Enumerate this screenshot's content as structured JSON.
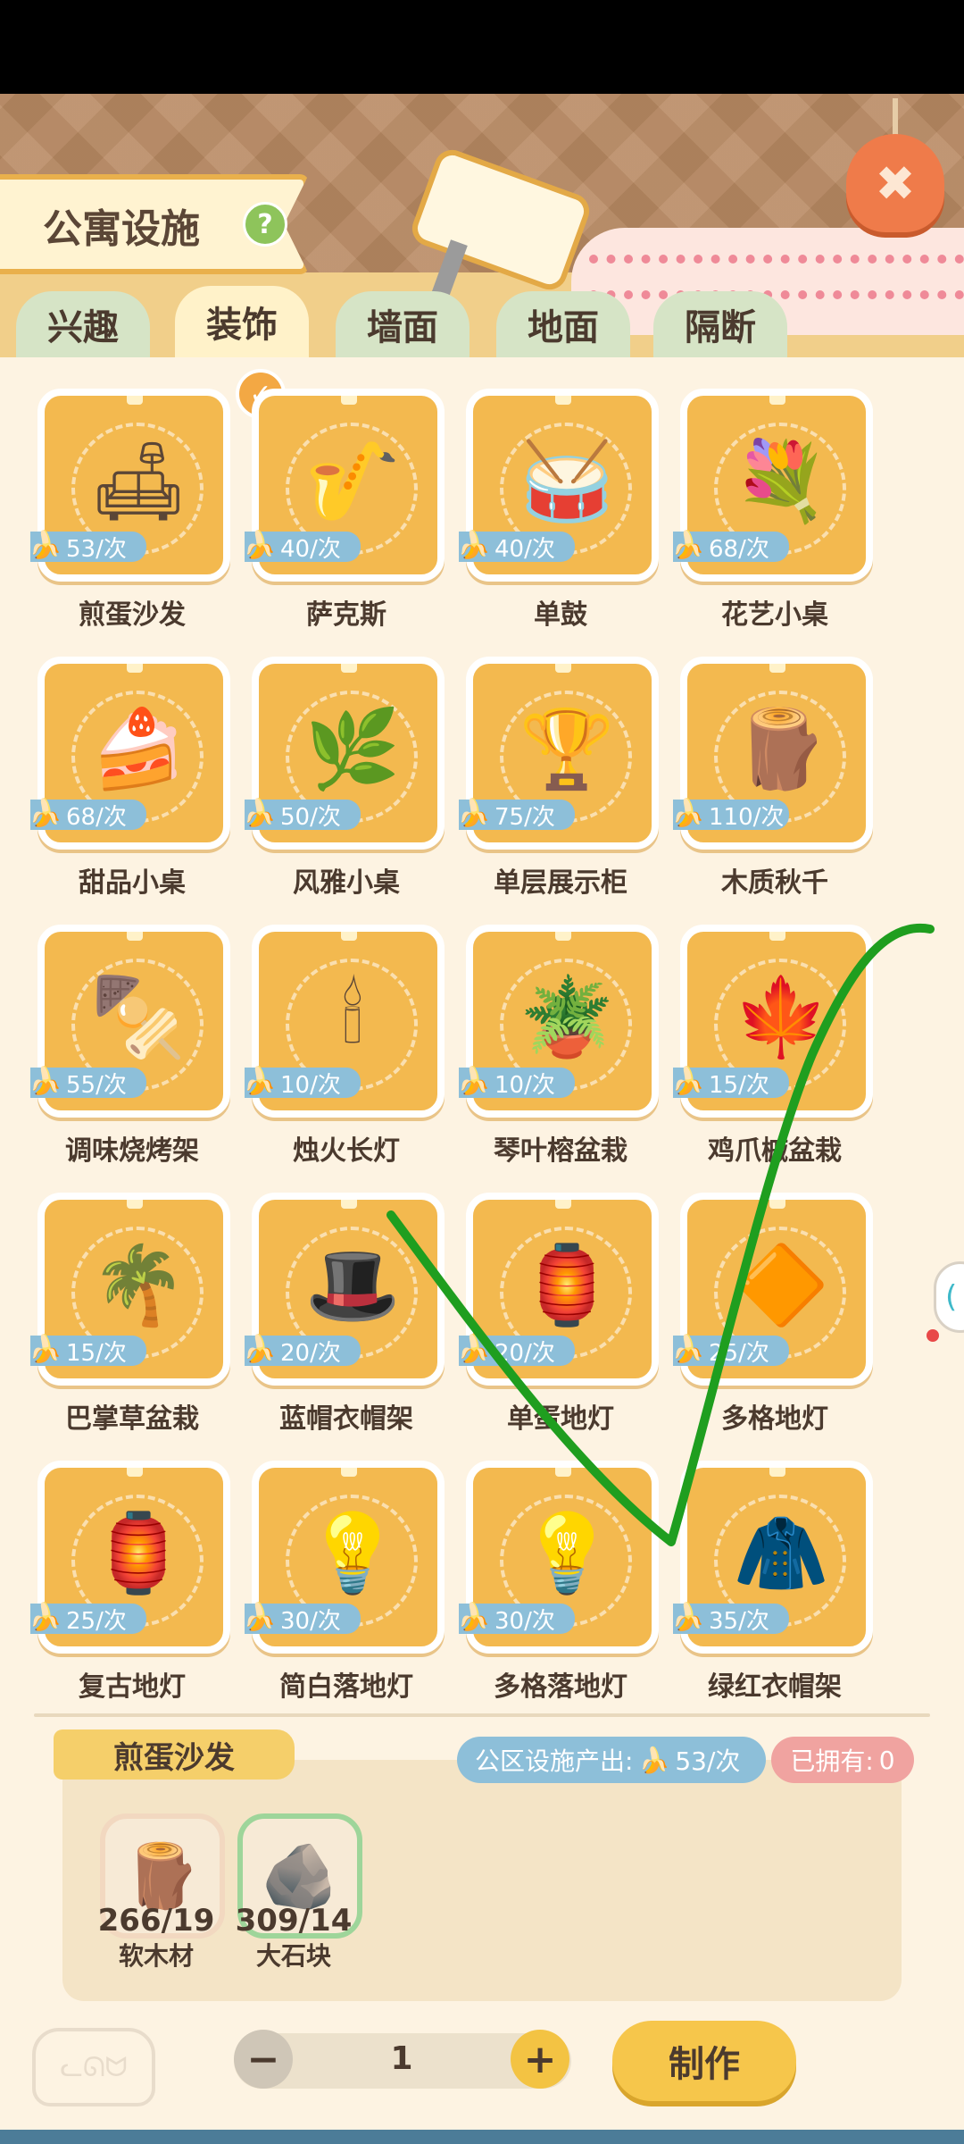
{
  "header": {
    "title": "公寓设施",
    "help_label": "?",
    "close_label": "✖"
  },
  "tabs": [
    {
      "label": "兴趣",
      "active": false
    },
    {
      "label": "装饰",
      "active": true
    },
    {
      "label": "墙面",
      "active": false
    },
    {
      "label": "地面",
      "active": false
    },
    {
      "label": "隔断",
      "active": false
    }
  ],
  "items": [
    {
      "name": "煎蛋沙发",
      "price": "53/次",
      "icon": "🛋",
      "selected": true
    },
    {
      "name": "萨克斯",
      "price": "40/次",
      "icon": "🎷"
    },
    {
      "name": "单鼓",
      "price": "40/次",
      "icon": "🥁"
    },
    {
      "name": "花艺小桌",
      "price": "68/次",
      "icon": "💐"
    },
    {
      "name": "甜品小桌",
      "price": "68/次",
      "icon": "🍰"
    },
    {
      "name": "风雅小桌",
      "price": "50/次",
      "icon": "🌿"
    },
    {
      "name": "单层展示柜",
      "price": "75/次",
      "icon": "🏆"
    },
    {
      "name": "木质秋千",
      "price": "110/次",
      "icon": "🪵"
    },
    {
      "name": "调味烧烤架",
      "price": "55/次",
      "icon": "🍢"
    },
    {
      "name": "烛火长灯",
      "price": "10/次",
      "icon": "🕯"
    },
    {
      "name": "琴叶榕盆栽",
      "price": "10/次",
      "icon": "🪴"
    },
    {
      "name": "鸡爪槭盆栽",
      "price": "15/次",
      "icon": "🍁"
    },
    {
      "name": "巴掌草盆栽",
      "price": "15/次",
      "icon": "🌴"
    },
    {
      "name": "蓝帽衣帽架",
      "price": "20/次",
      "icon": "🎩"
    },
    {
      "name": "单蛋地灯",
      "price": "20/次",
      "icon": "🏮"
    },
    {
      "name": "多格地灯",
      "price": "25/次",
      "icon": "🔶"
    },
    {
      "name": "复古地灯",
      "price": "25/次",
      "icon": "🏮"
    },
    {
      "name": "简白落地灯",
      "price": "30/次",
      "icon": "💡"
    },
    {
      "name": "多格落地灯",
      "price": "30/次",
      "icon": "💡"
    },
    {
      "name": "绿红衣帽架",
      "price": "35/次",
      "icon": "🧥"
    }
  ],
  "detail": {
    "name": "煎蛋沙发",
    "output_label": "公区设施产出:",
    "output_value": "53/次",
    "owned_label": "已拥有:",
    "owned_value": "0",
    "materials": [
      {
        "count": "266/19",
        "name": "软木材",
        "icon": "🪵"
      },
      {
        "count": "309/14",
        "name": "大石块",
        "icon": "🪨"
      }
    ]
  },
  "controls": {
    "minus": "−",
    "plus": "+",
    "quantity": "1",
    "make_label": "制作"
  },
  "icons": {
    "banana": "🍌",
    "check": "✓"
  },
  "colors": {
    "tile": "#f3b94f",
    "price_badge": "#8dbfd9",
    "accent": "#f6c64b",
    "stroke": "#1f9e1f"
  }
}
